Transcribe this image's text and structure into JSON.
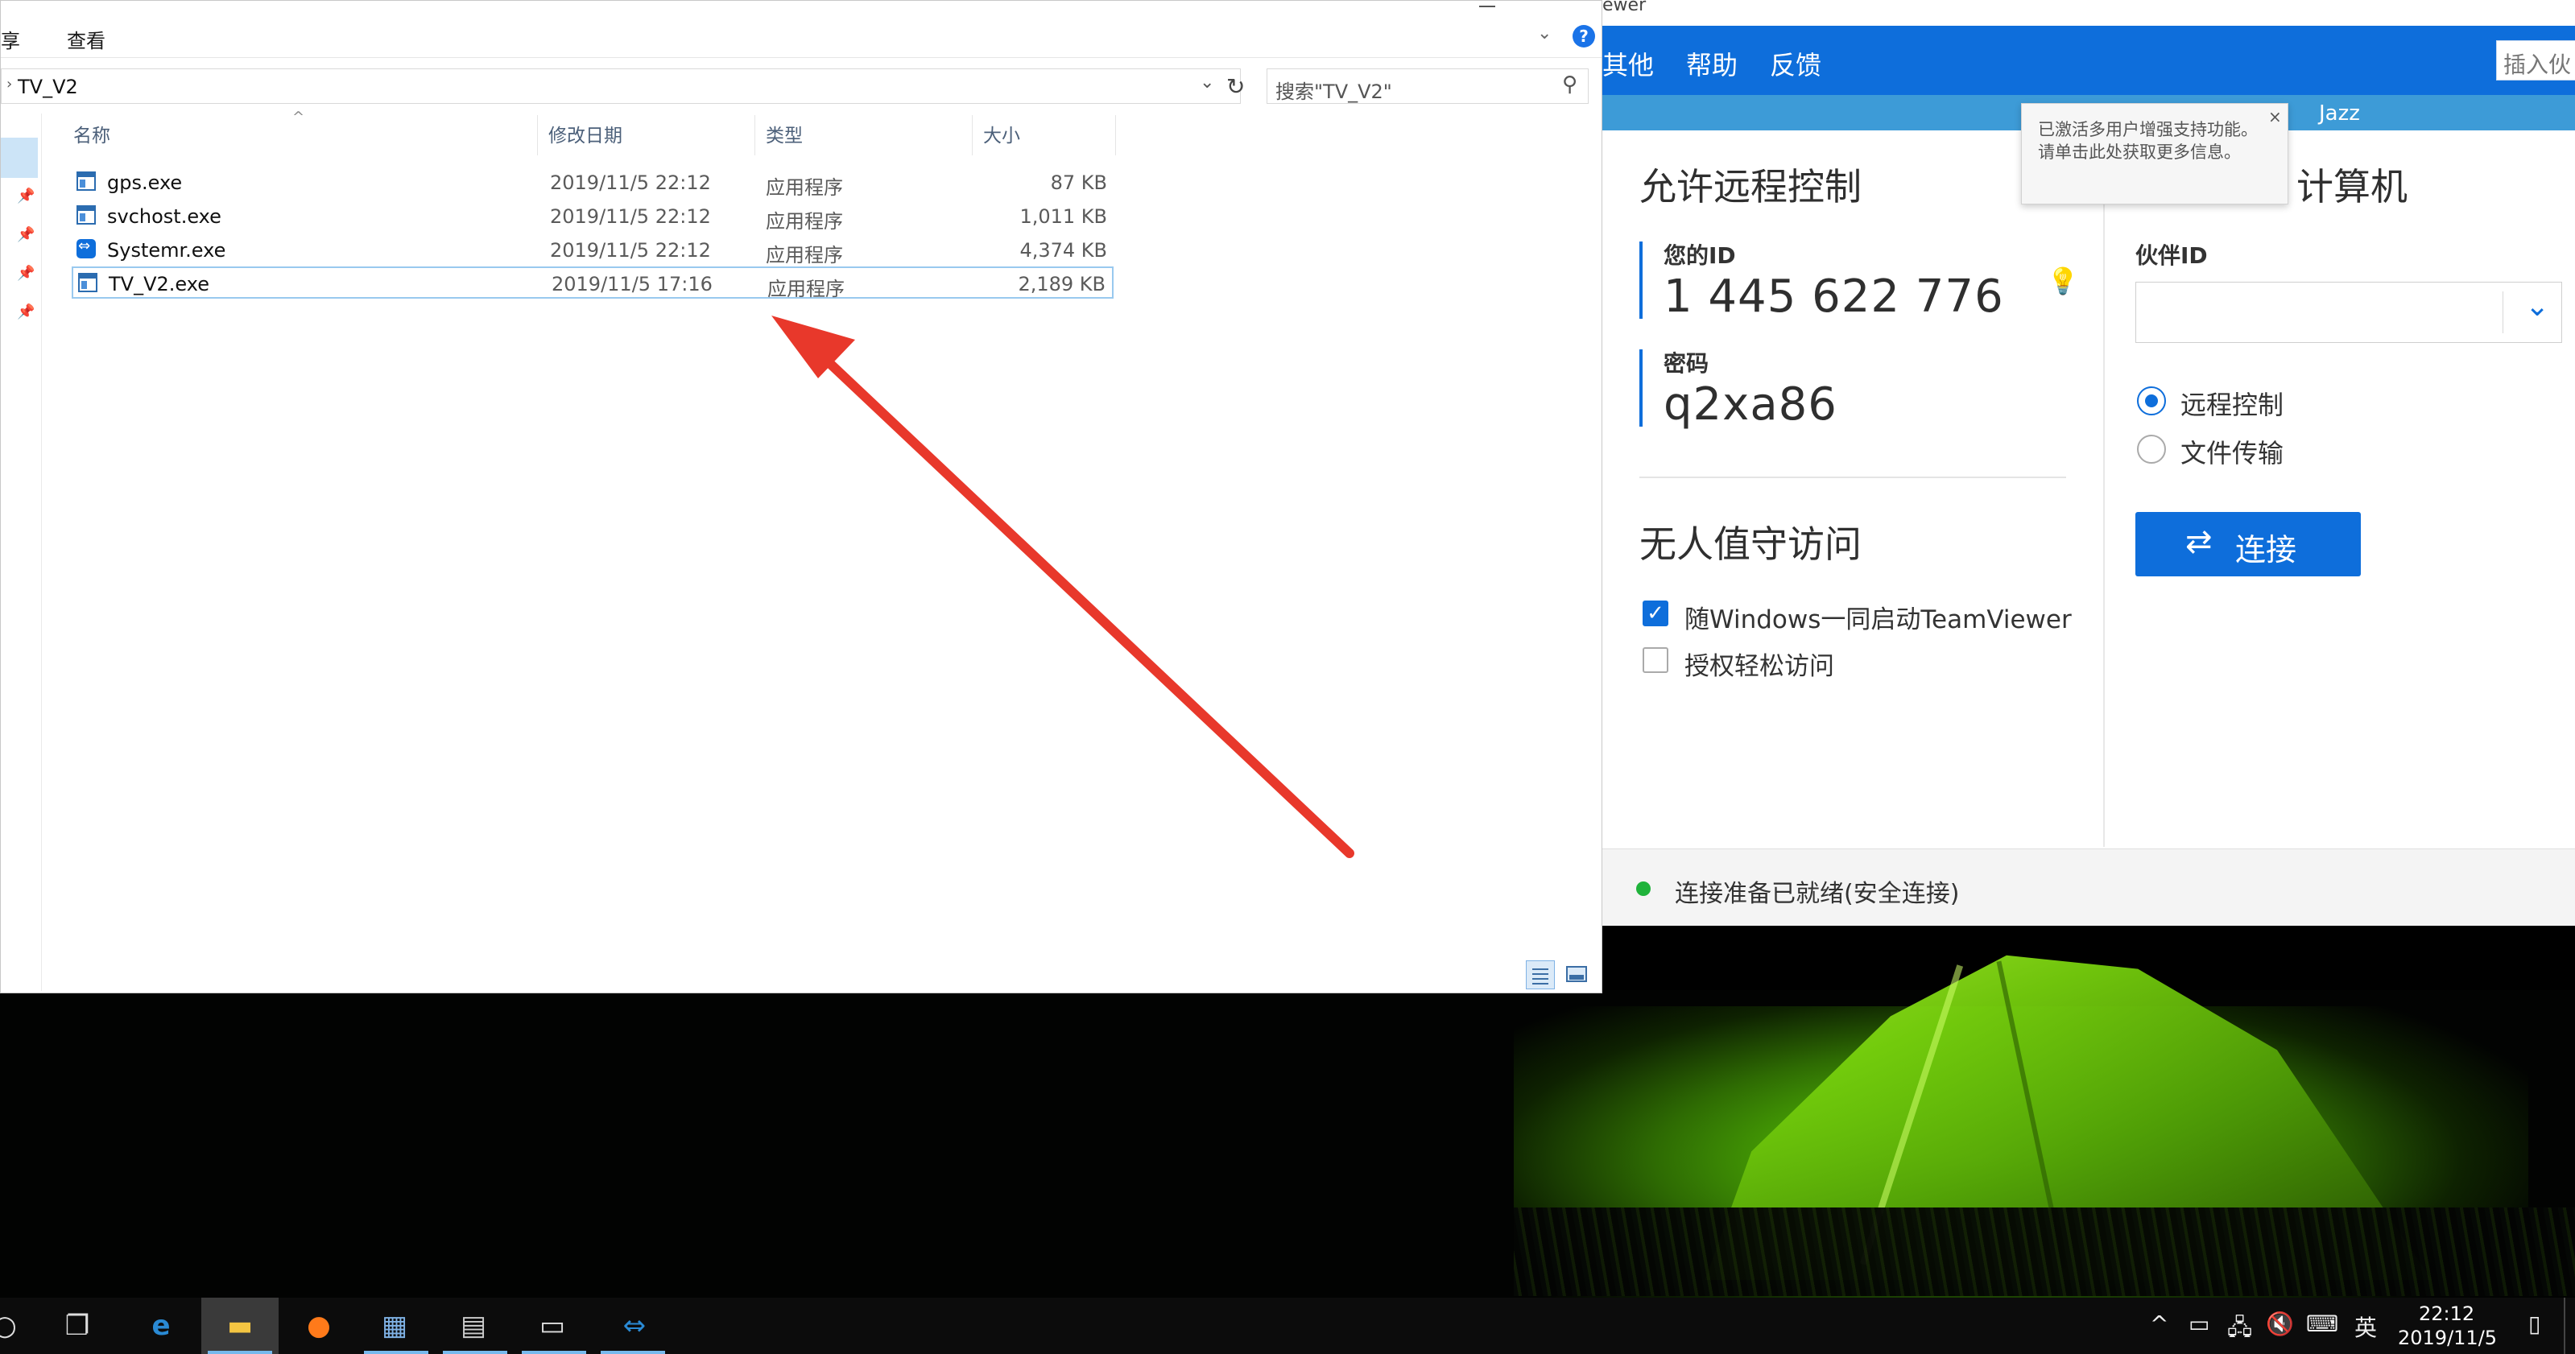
{
  "explorer": {
    "ribbon_tabs": [
      "享",
      "查看"
    ],
    "address": "TV_V2",
    "search_placeholder": "搜索\"TV_V2\"",
    "columns": [
      "名称",
      "修改日期",
      "类型",
      "大小"
    ],
    "files": [
      {
        "name": "gps.exe",
        "date": "2019/11/5 22:12",
        "type": "应用程序",
        "size": "87 KB",
        "icon": "exe-icon"
      },
      {
        "name": "svchost.exe",
        "date": "2019/11/5 22:12",
        "type": "应用程序",
        "size": "1,011 KB",
        "icon": "exe-icon"
      },
      {
        "name": "Systemr.exe",
        "date": "2019/11/5 22:12",
        "type": "应用程序",
        "size": "4,374 KB",
        "icon": "teamviewer-icon"
      },
      {
        "name": "TV_V2.exe",
        "date": "2019/11/5 17:16",
        "type": "应用程序",
        "size": "2,189 KB",
        "icon": "exe-icon"
      }
    ]
  },
  "teamviewer": {
    "title_fragment": "ewer",
    "menu": [
      "其他",
      "帮助",
      "反馈"
    ],
    "search_text": "插入伙",
    "subbar_text": "Jazz",
    "tooltip": "已激活多用户增强支持功能。请单击此处获取更多信息。",
    "allow_title": "允许远程控制",
    "your_id_label": "您的ID",
    "your_id": "1 445 622 776",
    "password_label": "密码",
    "password": "q2xa86",
    "unattended_title": "无人值守访问",
    "checkbox_start": "随Windows一同启动TeamViewer",
    "checkbox_easy": "授权轻松访问",
    "control_title": "计算机",
    "partner_id_label": "伙伴ID",
    "radio_remote": "远程控制",
    "radio_file": "文件传输",
    "connect": "连接",
    "status": "连接准备已就绪(安全连接)",
    "colors": {
      "accent": "#0e6edb",
      "status_ok": "#1fb33b"
    }
  },
  "annotation": {
    "arrow_color": "#e8382b"
  },
  "taskbar": {
    "icons": [
      "search-icon",
      "task-view-icon",
      "edge-icon",
      "file-explorer-icon",
      "firefox-icon",
      "server-manager-icon",
      "network-icon",
      "terminal-icon",
      "teamviewer-icon"
    ],
    "lang": "英",
    "time": "22:12",
    "date": "2019/11/5"
  }
}
